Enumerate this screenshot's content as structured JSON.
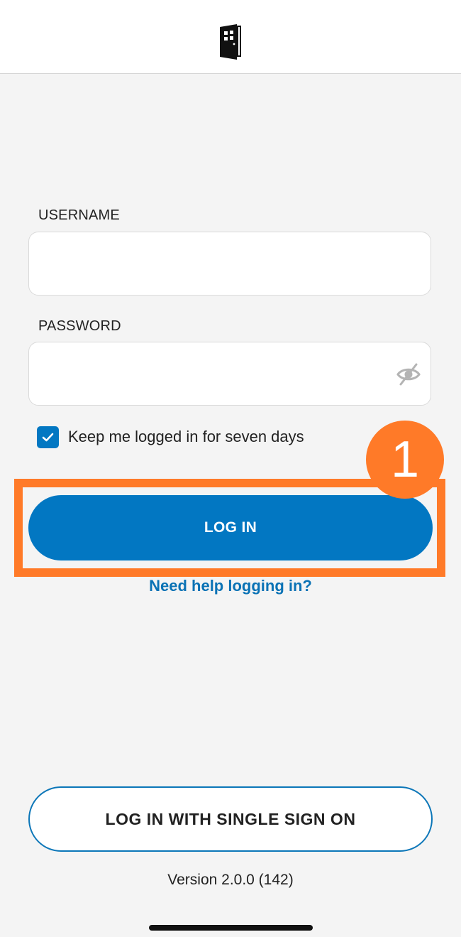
{
  "header": {
    "logo_icon": "door-icon"
  },
  "form": {
    "username_label": "USERNAME",
    "username_value": "",
    "password_label": "PASSWORD",
    "password_value": "",
    "password_toggle_icon": "eye-off-icon",
    "keep_logged_in_label": "Keep me logged in for seven days",
    "keep_logged_in_checked": true,
    "login_label": "LOG IN",
    "help_link": "Need help logging in?"
  },
  "annotation": {
    "step_number": "1",
    "color": "#ff7a28"
  },
  "sso": {
    "label": "LOG IN WITH SINGLE SIGN ON"
  },
  "footer": {
    "version": "Version 2.0.0 (142)"
  },
  "colors": {
    "primary": "#0277c2",
    "background": "#f4f4f4",
    "link": "#0a72b5"
  }
}
